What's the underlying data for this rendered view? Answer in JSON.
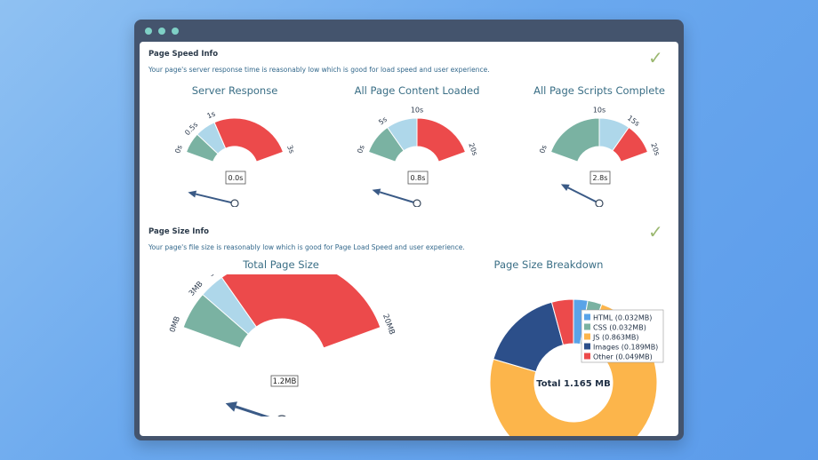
{
  "speed": {
    "title": "Page Speed Info",
    "description": "Your page's server response time is reasonably low which is good for load speed and user experience.",
    "check": "✓"
  },
  "size": {
    "title": "Page Size Info",
    "description": "Your page's file size is reasonably low which is good for Page Load Speed and user experience.",
    "check": "✓"
  },
  "colors": {
    "green": "#7ab2a2",
    "light_blue": "#aed7ea",
    "red": "#ec4a4b",
    "needle": "#3a5a86",
    "orange": "#fcb54b",
    "navy": "#2c4f8a",
    "blue": "#5aa3e8",
    "teal": "#7ab2a2"
  },
  "gauges": {
    "server": {
      "title": "Server Response",
      "ticks": [
        "0s",
        "0.5s",
        "1s",
        "3s"
      ],
      "value": 0.0,
      "value_label": "0.0s",
      "bands": [
        0,
        0.5,
        1,
        3
      ]
    },
    "content": {
      "title": "All Page Content Loaded",
      "ticks": [
        "0s",
        "5s",
        "10s",
        "20s"
      ],
      "value": 0.8,
      "value_label": "0.8s",
      "bands": [
        0,
        5,
        10,
        20
      ]
    },
    "scripts": {
      "title": "All Page Scripts Complete",
      "ticks": [
        "0s",
        "10s",
        "15s",
        "20s"
      ],
      "value": 2.8,
      "value_label": "2.8s",
      "bands": [
        0,
        10,
        15,
        20
      ]
    },
    "pagesize": {
      "title": "Total Page Size",
      "ticks": [
        "0MB",
        "3MB",
        "5MB",
        "20MB"
      ],
      "value": 1.2,
      "value_label": "1.2MB",
      "bands": [
        0,
        3,
        5,
        20
      ]
    }
  },
  "chart_data": {
    "type": "pie",
    "title": "Page Size Breakdown",
    "center_label": "Total 1.165 MB",
    "categories": [
      "HTML (0.032MB)",
      "CSS (0.032MB)",
      "JS (0.863MB)",
      "Images (0.189MB)",
      "Other (0.049MB)"
    ],
    "values": [
      0.032,
      0.032,
      0.863,
      0.189,
      0.049
    ],
    "colors": [
      "#5aa3e8",
      "#7ab2a2",
      "#fcb54b",
      "#2c4f8a",
      "#ec4a4b"
    ],
    "legend": "top-right"
  }
}
